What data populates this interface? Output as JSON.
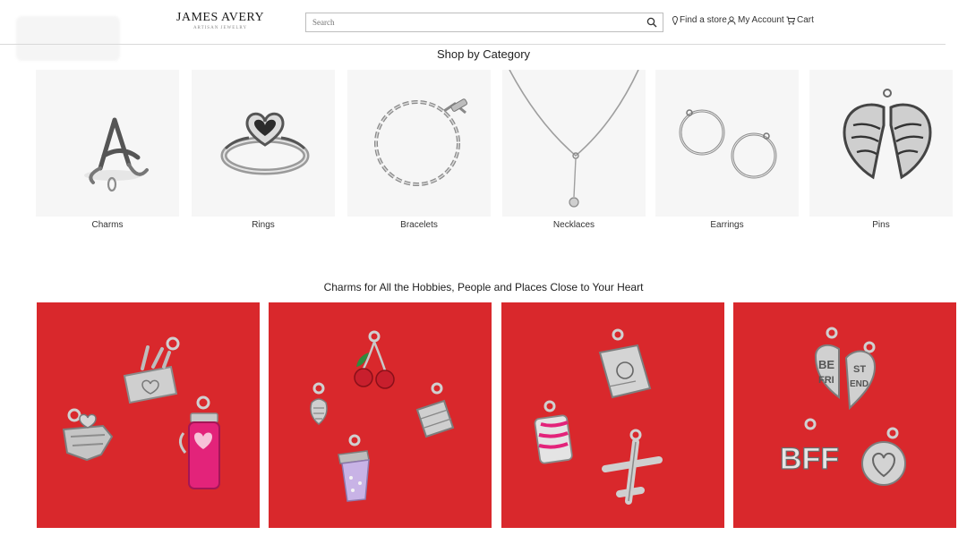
{
  "header": {
    "logo_text": "JAMES AVERY",
    "logo_tagline": "ARTISAN JEWELRY",
    "search_placeholder": "Search",
    "nav": [
      {
        "label": "Find a store",
        "icon": "location-icon"
      },
      {
        "label": "My Account",
        "icon": "user-icon"
      },
      {
        "label": "Cart",
        "icon": "cart-icon"
      }
    ]
  },
  "categories": {
    "title": "Shop by Category",
    "items": [
      {
        "label": "Charms",
        "icon": "letter-charm-image"
      },
      {
        "label": "Rings",
        "icon": "heart-ring-image"
      },
      {
        "label": "Bracelets",
        "icon": "chain-bracelet-image"
      },
      {
        "label": "Necklaces",
        "icon": "lariat-necklace-image"
      },
      {
        "label": "Earrings",
        "icon": "hoop-earrings-image"
      },
      {
        "label": "Pins",
        "icon": "angel-wings-image"
      }
    ]
  },
  "charms_section": {
    "title": "Charms for All the Hobbies, People and Places Close to Your Heart",
    "tiles": [
      {
        "name": "craft-charms-tile"
      },
      {
        "name": "food-charms-tile"
      },
      {
        "name": "travel-charms-tile"
      },
      {
        "name": "friendship-charms-tile"
      }
    ],
    "charm_texts": {
      "best": "BE",
      "fri": "FRI",
      "st": "ST",
      "end": "END",
      "bff": "BFF"
    }
  },
  "colors": {
    "tile_background": "#d9282c",
    "silver": "#c9c9c9",
    "pink_enamel": "#e8247a",
    "lavender_enamel": "#c9b4e6"
  }
}
